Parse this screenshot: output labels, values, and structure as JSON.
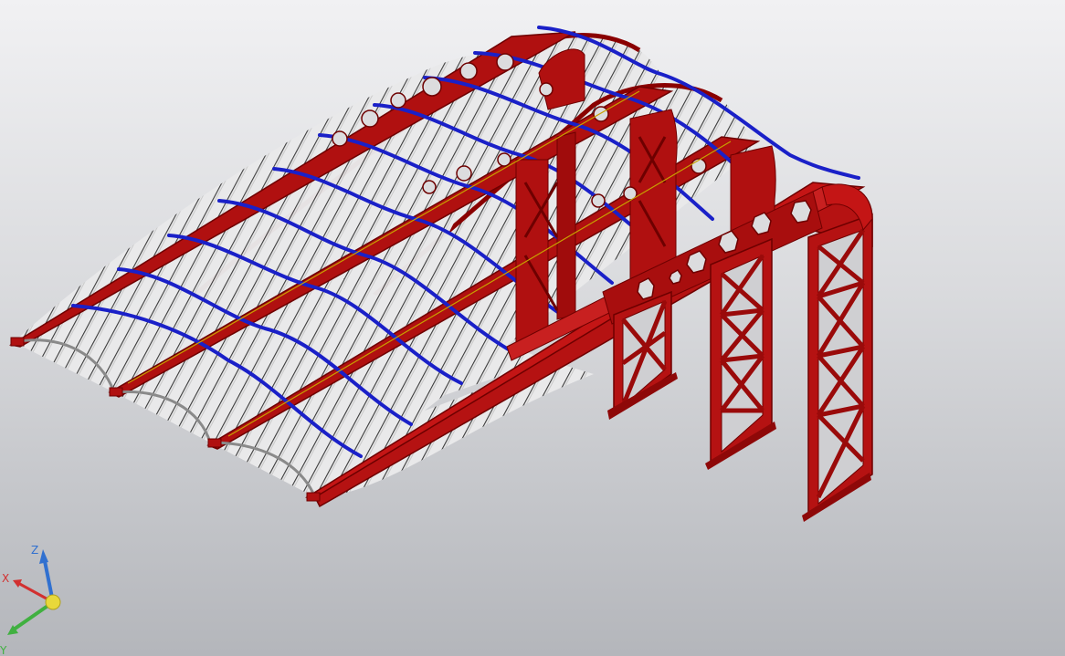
{
  "viewport": {
    "background_top": "#f1f1f3",
    "background_bottom": "#b4b6bb"
  },
  "model": {
    "colors": {
      "frame_red": "#b01010",
      "frame_red_dark": "#7a0000",
      "frame_red_light": "#d42020",
      "purlin_blue": "#1a20c8",
      "rib_dark": "#2a2a2a",
      "rib_light": "#cfcfcf",
      "accent_yellow": "#c8a000"
    }
  },
  "triad": {
    "x_label": "X",
    "y_label": "Y",
    "z_label": "Z",
    "x_color": "#d23030",
    "y_color": "#40b040",
    "z_color": "#3070d0",
    "origin_color": "#e8d83a"
  }
}
